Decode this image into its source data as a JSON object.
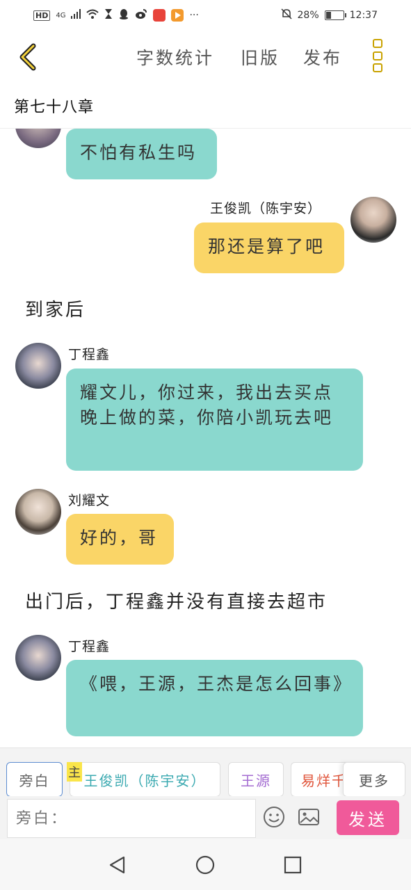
{
  "status": {
    "hd": "HD",
    "network": "4G",
    "battery": "28%",
    "battery_level": 0.28,
    "time": "12:37",
    "more": "···"
  },
  "nav": {
    "word_count": "字数统计",
    "old_version": "旧版",
    "publish": "发布"
  },
  "chapter_title": "第七十八章",
  "chat": {
    "m0": {
      "text": "不怕有私生吗"
    },
    "m1": {
      "name": "王俊凯（陈宇安）",
      "text": "那还是算了吧"
    },
    "n1": "到家后",
    "m2": {
      "name": "丁程鑫",
      "text": "耀文儿，你过来，我出去买点晚上做的菜，你陪小凯玩去吧"
    },
    "m3": {
      "name": "刘耀文",
      "text": "好的，哥"
    },
    "n2": "出门后，丁程鑫并没有直接去超市",
    "m4": {
      "name": "丁程鑫",
      "text": "《喂，王源，王杰是怎么回事》"
    }
  },
  "roles": {
    "narration": "旁白",
    "main_tag": "主",
    "main_role": "王俊凯（陈宇安）",
    "role2": "王源",
    "role3": "易烊千玺",
    "more": "更多"
  },
  "input": {
    "placeholder": "旁白：",
    "send": "发送"
  },
  "colors": {
    "teal_bubble": "#8ad8ce",
    "yellow_bubble": "#fad567",
    "send": "#f05a9a",
    "accent": "#c9a200"
  }
}
